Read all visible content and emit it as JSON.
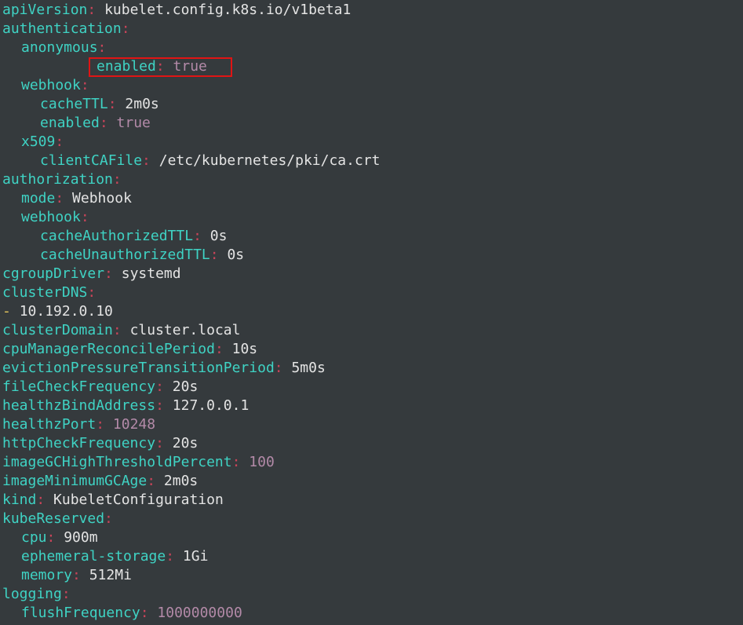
{
  "editor": {
    "language": "yaml",
    "colors": {
      "background": "#353a3d",
      "key": "#3fd3c4",
      "colon": "#c94459",
      "string_value": "#e4e4e4",
      "number_boolean_value": "#b38aa8",
      "list_dash": "#e3c45c",
      "highlight_box": "#e01414"
    },
    "highlighted_line": "authentication.anonymous.enabled",
    "lines": [
      {
        "key": "apiVersion",
        "value": "kubelet.config.k8s.io/v1beta1"
      },
      {
        "key": "authentication"
      },
      {
        "key": "anonymous"
      },
      {
        "key": "enabled",
        "value": "true"
      },
      {
        "key": "webhook"
      },
      {
        "key": "cacheTTL",
        "value": "2m0s"
      },
      {
        "key": "enabled",
        "value": "true"
      },
      {
        "key": "x509"
      },
      {
        "key": "clientCAFile",
        "value": "/etc/kubernetes/pki/ca.crt"
      },
      {
        "key": "authorization"
      },
      {
        "key": "mode",
        "value": "Webhook"
      },
      {
        "key": "webhook"
      },
      {
        "key": "cacheAuthorizedTTL",
        "value": "0s"
      },
      {
        "key": "cacheUnauthorizedTTL",
        "value": "0s"
      },
      {
        "key": "cgroupDriver",
        "value": "systemd"
      },
      {
        "key": "clusterDNS"
      },
      {
        "dash": "-",
        "value": "10.192.0.10"
      },
      {
        "key": "clusterDomain",
        "value": "cluster.local"
      },
      {
        "key": "cpuManagerReconcilePeriod",
        "value": "10s"
      },
      {
        "key": "evictionPressureTransitionPeriod",
        "value": "5m0s"
      },
      {
        "key": "fileCheckFrequency",
        "value": "20s"
      },
      {
        "key": "healthzBindAddress",
        "value": "127.0.0.1"
      },
      {
        "key": "healthzPort",
        "value": "10248"
      },
      {
        "key": "httpCheckFrequency",
        "value": "20s"
      },
      {
        "key": "imageGCHighThresholdPercent",
        "value": "100"
      },
      {
        "key": "imageMinimumGCAge",
        "value": "2m0s"
      },
      {
        "key": "kind",
        "value": "KubeletConfiguration"
      },
      {
        "key": "kubeReserved"
      },
      {
        "key": "cpu",
        "value": "900m"
      },
      {
        "key": "ephemeral-storage",
        "value": "1Gi"
      },
      {
        "key": "memory",
        "value": "512Mi"
      },
      {
        "key": "logging"
      },
      {
        "key": "flushFrequency",
        "value": "1000000000"
      }
    ]
  }
}
